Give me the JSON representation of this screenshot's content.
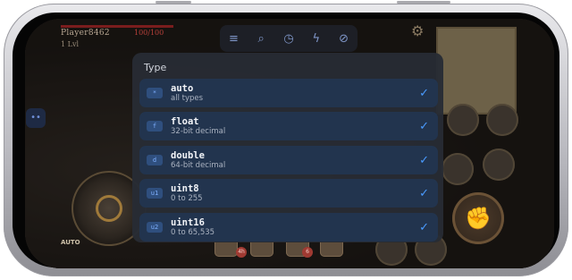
{
  "game": {
    "player_name": "Player8462",
    "hp": "100/100",
    "level": "1 Lvl",
    "auto_label": "AUTO",
    "badge_counts": [
      "4h",
      "6"
    ]
  },
  "toolbar": {
    "icons": [
      "menu-icon",
      "search-icon",
      "history-icon",
      "bolt-icon",
      "compass-icon"
    ]
  },
  "type_picker": {
    "title": "Type",
    "options": [
      {
        "badge": "*",
        "name": "auto",
        "description": "all types",
        "checked": true
      },
      {
        "badge": "f",
        "name": "float",
        "description": "32-bit decimal",
        "checked": true
      },
      {
        "badge": "d",
        "name": "double",
        "description": "64-bit decimal",
        "checked": true
      },
      {
        "badge": "u1",
        "name": "uint8",
        "description": "0 to 255",
        "checked": true
      },
      {
        "badge": "u2",
        "name": "uint16",
        "description": "0 to 65,535",
        "checked": true
      }
    ]
  },
  "colors": {
    "accent": "#4a9bff",
    "sheet_bg": "#282c34",
    "row_bg": "#22344e"
  }
}
